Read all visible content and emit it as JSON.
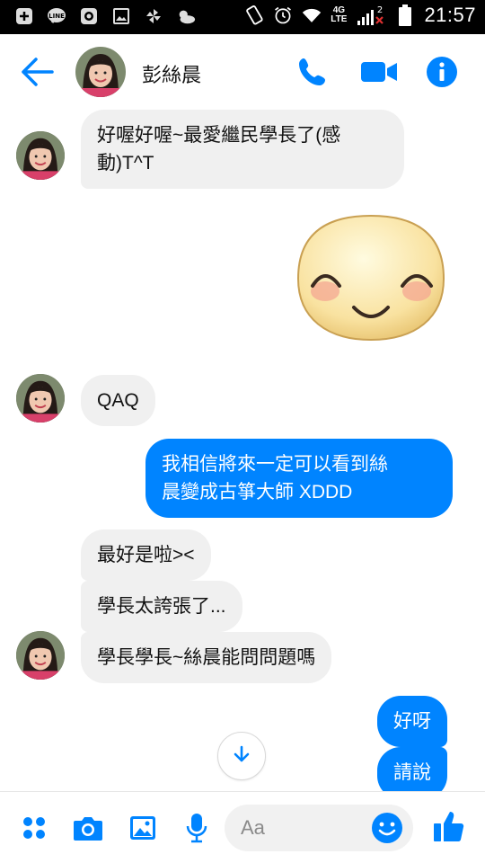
{
  "status_bar": {
    "time": "21:57",
    "network_type": "4G",
    "network_sub": "LTE",
    "sim_slot": "2",
    "icons": [
      "plus-box-icon",
      "line-app-icon",
      "mail-app-icon",
      "image-icon",
      "pinwheel-icon",
      "weather-icon",
      "rotate-icon",
      "alarm-icon",
      "wifi-icon",
      "signal-icon",
      "battery-icon"
    ]
  },
  "header": {
    "contact_name": "彭絲晨",
    "icons": [
      "back-arrow-icon",
      "phone-icon",
      "video-camera-icon",
      "info-icon"
    ]
  },
  "messages": [
    {
      "id": "m1",
      "side": "in",
      "lines": [
        "好喔好喔~最愛繼民學長了(感",
        "動)T^T"
      ]
    },
    {
      "id": "m2",
      "side": "out",
      "type": "sticker",
      "sticker": "smiling-face-sticker"
    },
    {
      "id": "m3",
      "side": "in",
      "lines": [
        "QAQ"
      ]
    },
    {
      "id": "m4",
      "side": "out",
      "lines": [
        "我相信將來一定可以看到絲",
        "晨變成古箏大師 XDDD"
      ]
    },
    {
      "id": "m5",
      "side": "in",
      "lines": [
        "最好是啦><"
      ]
    },
    {
      "id": "m6",
      "side": "in",
      "lines": [
        "學長太誇張了..."
      ]
    },
    {
      "id": "m7",
      "side": "in",
      "lines": [
        "學長學長~絲晨能問問題嗎"
      ]
    },
    {
      "id": "m8",
      "side": "out",
      "lines": [
        "好呀"
      ]
    },
    {
      "id": "m9",
      "side": "out",
      "lines": [
        "請說"
      ]
    }
  ],
  "composer": {
    "placeholder": "Aa",
    "icons": [
      "apps-grid-icon",
      "camera-icon",
      "gallery-icon",
      "microphone-icon",
      "emoji-icon",
      "thumbs-up-icon"
    ]
  },
  "colors": {
    "accent": "#0084ff",
    "incoming_bubble": "#f0f0f0",
    "status_bar": "#000000"
  }
}
